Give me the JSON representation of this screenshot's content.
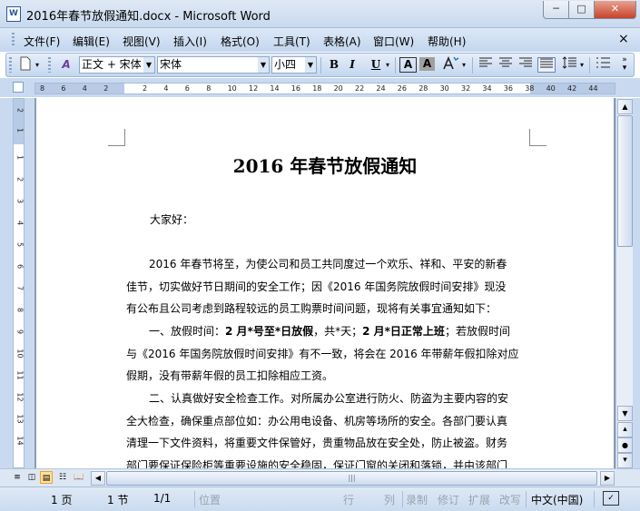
{
  "window": {
    "title": "2016年春节放假通知.docx - Microsoft Word",
    "app_icon": "W",
    "min_symbol": "─",
    "max_symbol": "□",
    "close_symbol": "✕"
  },
  "menu": {
    "items": [
      "文件(F)",
      "编辑(E)",
      "视图(V)",
      "插入(I)",
      "格式(O)",
      "工具(T)",
      "表格(A)",
      "窗口(W)",
      "帮助(H)"
    ],
    "close_symbol": "×"
  },
  "toolbar": {
    "style_value": "正文 + 宋体",
    "font_value": "宋体",
    "size_value": "小四",
    "bold": "B",
    "italic": "I",
    "underline": "U",
    "char_border": "A",
    "char_shading": "A",
    "styles_icon_text": "A"
  },
  "ruler": {
    "ticks": [
      "8",
      "6",
      "4",
      "2",
      "2",
      "4",
      "6",
      "8",
      "10",
      "12",
      "14",
      "16",
      "18",
      "20",
      "22",
      "24",
      "26",
      "28",
      "30",
      "32",
      "34",
      "36",
      "38",
      "40",
      "42",
      "44",
      "46",
      "48"
    ],
    "v_ticks": [
      "2",
      "1",
      "1",
      "2",
      "3",
      "4",
      "5",
      "6",
      "7",
      "8",
      "9",
      "10",
      "11",
      "12",
      "13",
      "14",
      "15",
      "16",
      "17",
      "18",
      "19",
      "20"
    ]
  },
  "document": {
    "title": "2016 年春节放假通知",
    "greeting": "大家好：",
    "p1_line1": "2016 年春节将至，为使公司和员工共同度过一个欢乐、祥和、平安的新春",
    "p1_line2": "佳节，切实做好节日期间的安全工作；因《2016 年国务院放假时间安排》现没",
    "p1_line3": "有公布且公司考虑到路程较远的员工购票时间问题，现将有关事宜通知如下：",
    "p2_prefix": "一、放假时间：",
    "p2_bold1": "2 月*号至*日放假",
    "p2_mid": "，共*天；",
    "p2_bold2": "2 月*日正常上班",
    "p2_suffix": "；若放假时间",
    "p2_line2": "与《2016 年国务院放假时间安排》有不一致，将会在 2016 年带薪年假扣除对应",
    "p2_line3": "假期，没有带薪年假的员工扣除相应工资。",
    "p3_line1": "二、认真做好安全检查工作。对所属办公室进行防火、防盗为主要内容的安",
    "p3_line2": "全大检查，确保重点部位如：办公用电设备、机房等场所的安全。各部门要认真",
    "p3_line3": "清理一下文件资料，将重要文件保管好，贵重物品放在安全处，防止被盗。财务",
    "p3_line4": "部门要保证保险柜等重要设施的安全稳固，保证门窗的关闭和落锁，并由该部门"
  },
  "status": {
    "page": "1 页",
    "section": "1 节",
    "page_of": "1/1",
    "position": "位置",
    "line": "行",
    "column": "列",
    "record": "录制",
    "revise": "修订",
    "extend": "扩展",
    "overwrite": "改写",
    "language": "中文(中国)"
  },
  "colors": {
    "chrome": "#c9daf0",
    "title_close": "#c7432b"
  }
}
